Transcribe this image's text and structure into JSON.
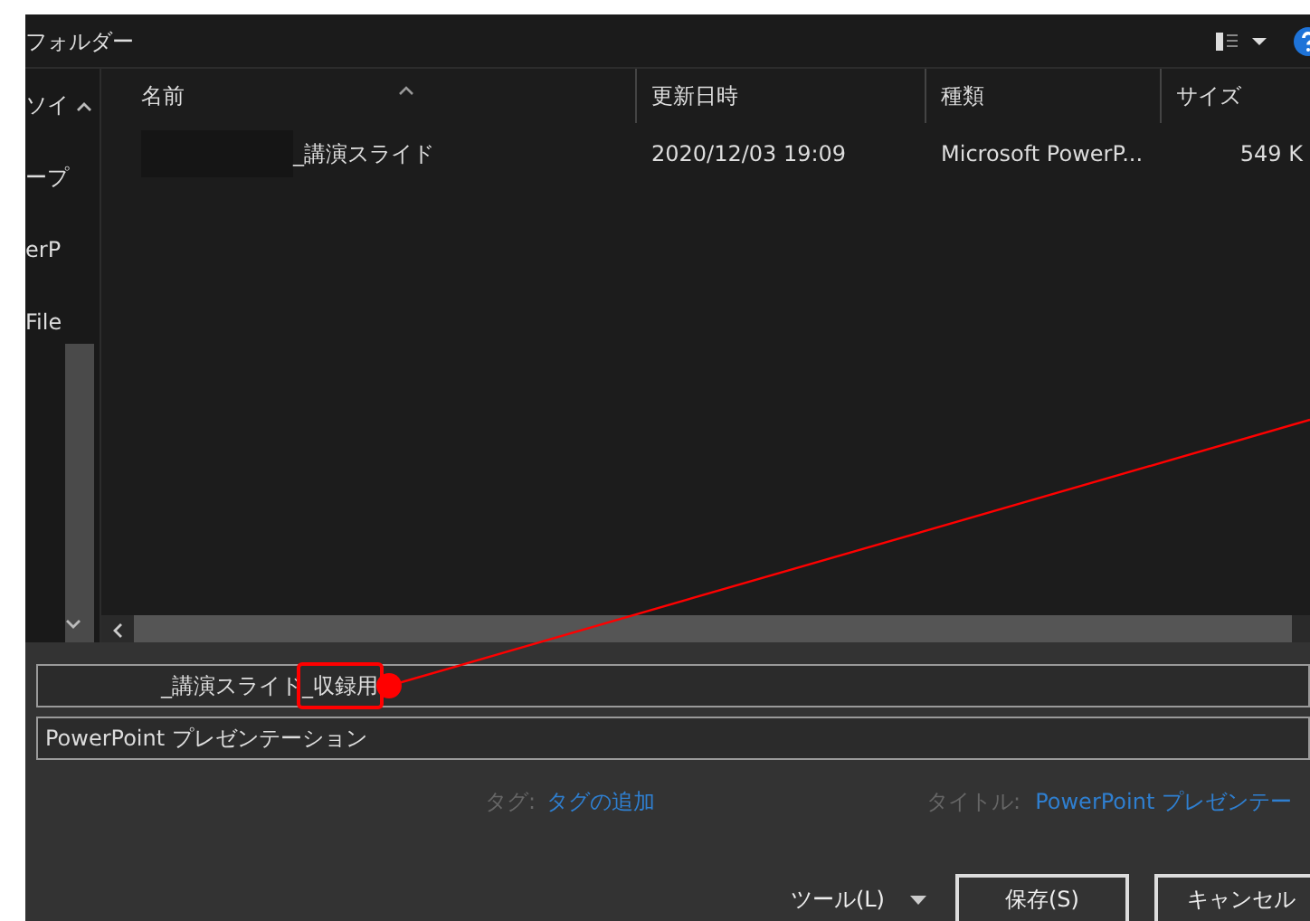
{
  "window": {
    "title": "フォルダー"
  },
  "nav_pane": {
    "items": [
      {
        "label": "ソイ"
      },
      {
        "label": "ープ"
      },
      {
        "label": "erP"
      },
      {
        "label": "File"
      }
    ]
  },
  "file_list": {
    "columns": [
      "名前",
      "更新日時",
      "種類",
      "サイズ"
    ],
    "rows": [
      {
        "name": "_講演スライド",
        "modified": "2020/12/03 19:09",
        "type": "Microsoft PowerP...",
        "size": "549 K"
      }
    ]
  },
  "save_form": {
    "file_name_parts": [
      {
        "text": "_講演スライド",
        "highlighted": false
      },
      {
        "text": "_収録用",
        "highlighted": true
      }
    ],
    "file_type": "PowerPoint プレゼンテーション",
    "tags_label": "タグ:",
    "tags_link": "タグの追加",
    "title_label": "タイトル:",
    "title_link": "PowerPoint プレゼンテー"
  },
  "buttons": {
    "tools": "ツール(L)",
    "save": "保存(S)",
    "cancel": "キャンセル"
  }
}
